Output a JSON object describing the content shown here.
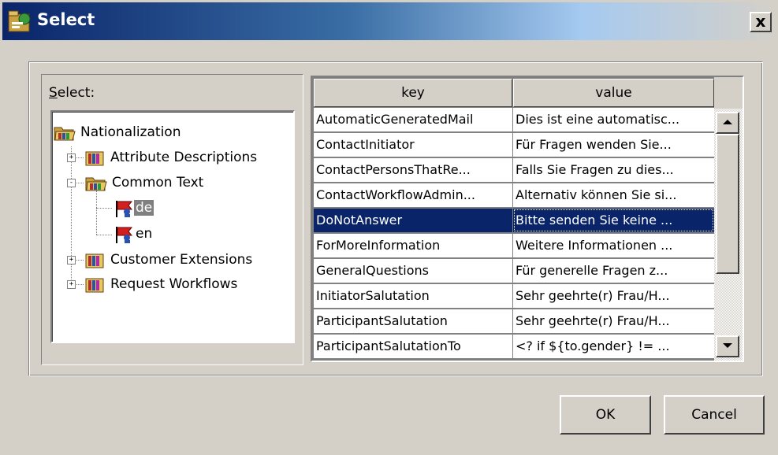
{
  "window": {
    "title": "Select",
    "close_label": "x"
  },
  "tree": {
    "label_prefix": "S",
    "label_rest": "elect:",
    "items": [
      {
        "label": "Nationalization",
        "icon": "folder-open-icon"
      },
      {
        "label": "Attribute Descriptions",
        "icon": "book-icon",
        "expander": "+"
      },
      {
        "label": "Common Text",
        "icon": "folder-open-icon",
        "expander": "-"
      },
      {
        "label": "de",
        "icon": "flag-person-icon",
        "selected": true
      },
      {
        "label": "en",
        "icon": "flag-person-icon"
      },
      {
        "label": "Customer Extensions",
        "icon": "book-icon",
        "expander": "+"
      },
      {
        "label": "Request Workflows",
        "icon": "book-icon",
        "expander": "+"
      }
    ]
  },
  "table": {
    "columns": [
      "key",
      "value"
    ],
    "rows": [
      {
        "key": "AutomaticGeneratedMail",
        "value": "Dies ist eine automatisc..."
      },
      {
        "key": "ContactInitiator",
        "value": "Für Fragen wenden Sie..."
      },
      {
        "key": "ContactPersonsThatRe...",
        "value": "Falls Sie Fragen zu dies..."
      },
      {
        "key": "ContactWorkflowAdmin...",
        "value": "Alternativ können Sie si..."
      },
      {
        "key": "DoNotAnswer",
        "value": "Bitte senden Sie keine ...",
        "selected": true
      },
      {
        "key": "ForMoreInformation",
        "value": "Weitere Informationen ..."
      },
      {
        "key": "GeneralQuestions",
        "value": "Für generelle Fragen z..."
      },
      {
        "key": "InitiatorSalutation",
        "value": "Sehr geehrte(r) Frau/H..."
      },
      {
        "key": "ParticipantSalutation",
        "value": "Sehr geehrte(r) Frau/H..."
      },
      {
        "key": "ParticipantSalutationTo",
        "value": "<? if ${to.gender} != ..."
      }
    ]
  },
  "buttons": {
    "ok": "OK",
    "cancel": "Cancel"
  },
  "colors": {
    "selection": "#0a246a",
    "face": "#d4d0c8",
    "title_start": "#0a246a"
  }
}
